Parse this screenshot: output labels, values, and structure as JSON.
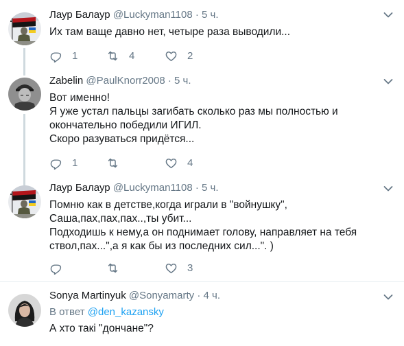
{
  "tweets": [
    {
      "name": "Лаур Балаур",
      "handle": "@Luckyman1108",
      "separator": "·",
      "time": "5 ч.",
      "lines": [
        "Их там ваще давно нет, четыре раза выводили..."
      ],
      "replies": "1",
      "retweets": "4",
      "likes": "2",
      "avatar": "flag-soldier"
    },
    {
      "name": "Zabelin",
      "handle": "@PaulKnorr2008",
      "separator": "·",
      "time": "5 ч.",
      "lines": [
        "Вот именно!",
        "Я уже устал пальцы загибать сколько раз мы полностью и",
        "окончательно победили ИГИЛ.",
        "Скоро разуваться придётся..."
      ],
      "replies": "1",
      "retweets": "",
      "likes": "4",
      "avatar": "portrait-cap"
    },
    {
      "name": "Лаур Балаур",
      "handle": "@Luckyman1108",
      "separator": "·",
      "time": "5 ч.",
      "lines": [
        "Помню как в детстве,когда играли в \"войнушку\",",
        "Саша,пах,пах,пах..,ты убит...",
        "Подходишь к нему,а он поднимает голову, направляет на тебя",
        "ствол,пах...\",а я как бы из последних сил...\". )"
      ],
      "replies": "",
      "retweets": "",
      "likes": "3",
      "avatar": "flag-soldier"
    },
    {
      "name": "Sonya Martinyuk",
      "handle": "@Sonyamarty",
      "separator": "·",
      "time": "4 ч.",
      "reply_prefix": "В ответ",
      "reply_mention": "@den_kazansky",
      "lines": [
        "А хто такі \"дончане\"?"
      ],
      "avatar": "woman-portrait"
    }
  ],
  "colors": {
    "text": "#14171a",
    "secondary": "#657786",
    "link": "#1da1f2",
    "divider": "#e6ecf0",
    "thread_line": "#cfd9de"
  }
}
